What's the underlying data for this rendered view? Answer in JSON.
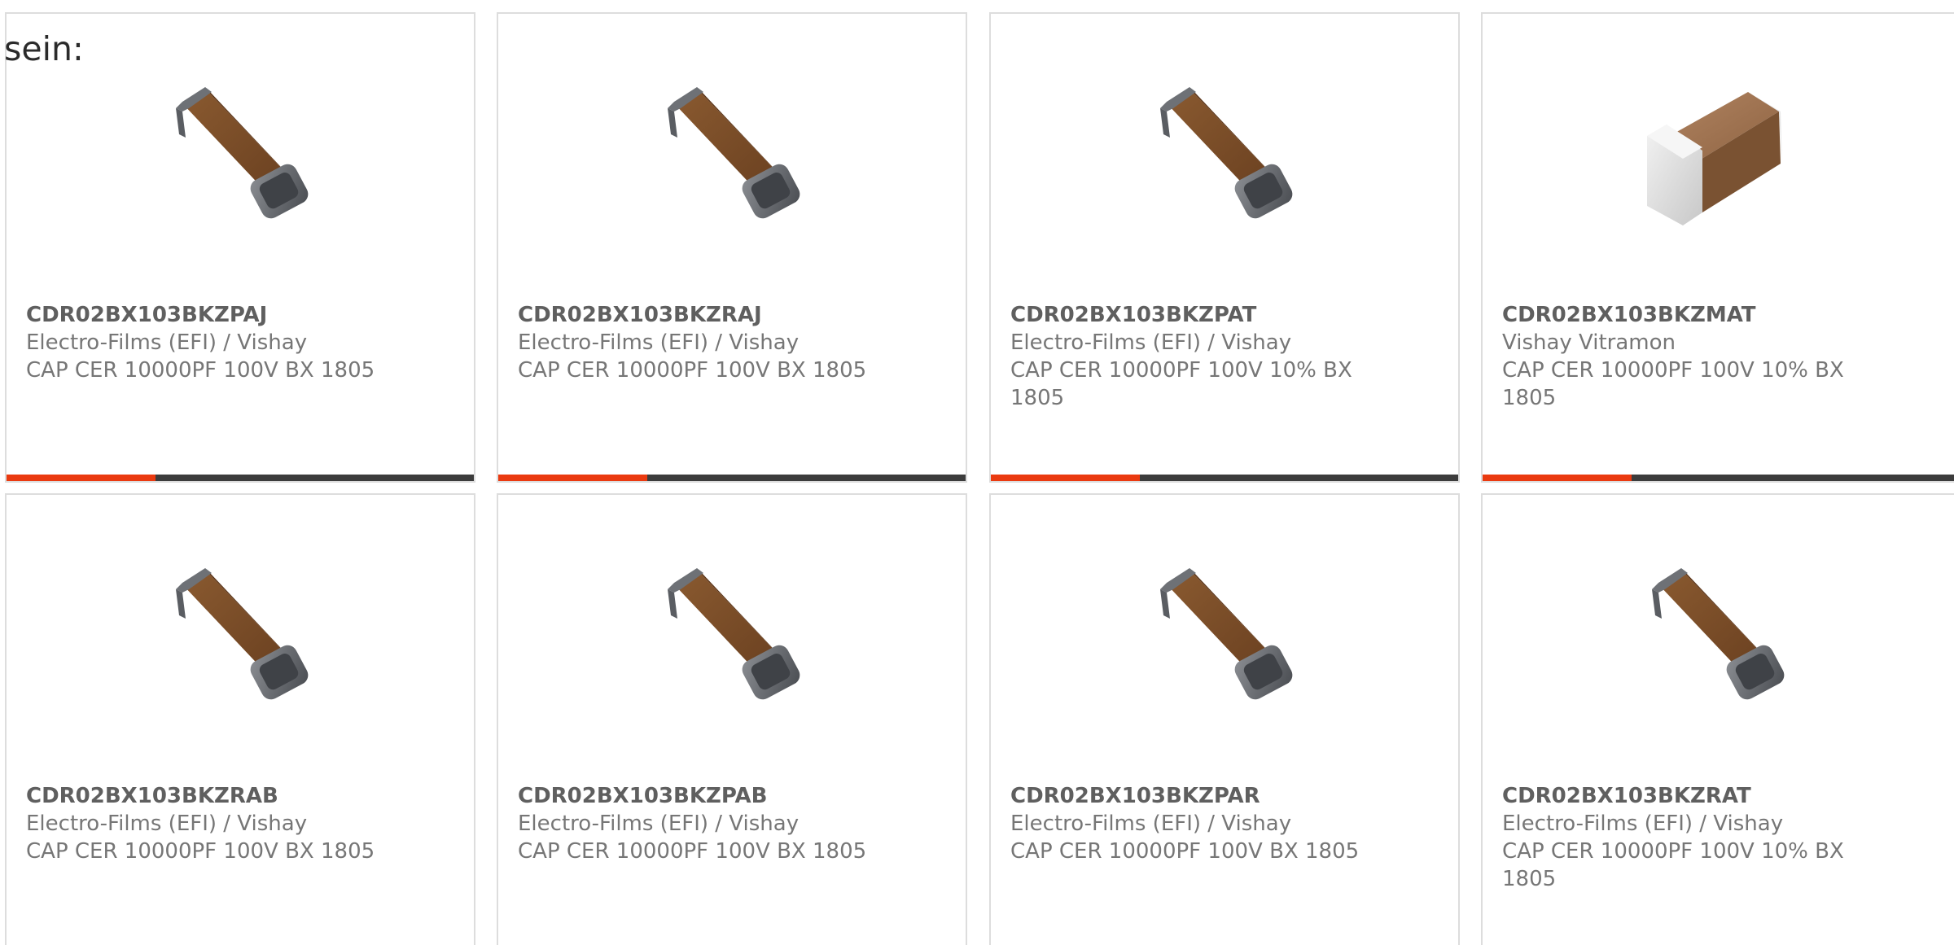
{
  "intro_text": "sein:",
  "colors": {
    "accent": "#ea3a10",
    "bar": "#3c3c3c",
    "border": "#dddddd",
    "title": "#5f5f5f",
    "text": "#767676"
  },
  "products": [
    {
      "part": "CDR02BX103BKZPAJ",
      "manufacturer": "Electro-Films (EFI) / Vishay",
      "description": "CAP CER 10000PF 100V BX 1805",
      "image": "ceramic-capacitor-brown-icon"
    },
    {
      "part": "CDR02BX103BKZRAJ",
      "manufacturer": "Electro-Films (EFI) / Vishay",
      "description": "CAP CER 10000PF 100V BX 1805",
      "image": "ceramic-capacitor-brown-icon"
    },
    {
      "part": "CDR02BX103BKZPAT",
      "manufacturer": "Electro-Films (EFI) / Vishay",
      "description": "CAP CER 10000PF 100V 10% BX 1805",
      "image": "ceramic-capacitor-brown-icon"
    },
    {
      "part": "CDR02BX103BKZMAT",
      "manufacturer": "Vishay Vitramon",
      "description": "CAP CER 10000PF 100V 10% BX 1805",
      "image": "ceramic-capacitor-tan-icon"
    },
    {
      "part": "CDR02BX103BKZRAB",
      "manufacturer": "Electro-Films (EFI) / Vishay",
      "description": "CAP CER 10000PF 100V BX 1805",
      "image": "ceramic-capacitor-brown-icon"
    },
    {
      "part": "CDR02BX103BKZPAB",
      "manufacturer": "Electro-Films (EFI) / Vishay",
      "description": "CAP CER 10000PF 100V BX 1805",
      "image": "ceramic-capacitor-brown-icon"
    },
    {
      "part": "CDR02BX103BKZPAR",
      "manufacturer": "Electro-Films (EFI) / Vishay",
      "description": "CAP CER 10000PF 100V BX 1805",
      "image": "ceramic-capacitor-brown-icon"
    },
    {
      "part": "CDR02BX103BKZRAT",
      "manufacturer": "Electro-Films (EFI) / Vishay",
      "description": "CAP CER 10000PF 100V 10% BX 1805",
      "image": "ceramic-capacitor-brown-icon"
    }
  ]
}
